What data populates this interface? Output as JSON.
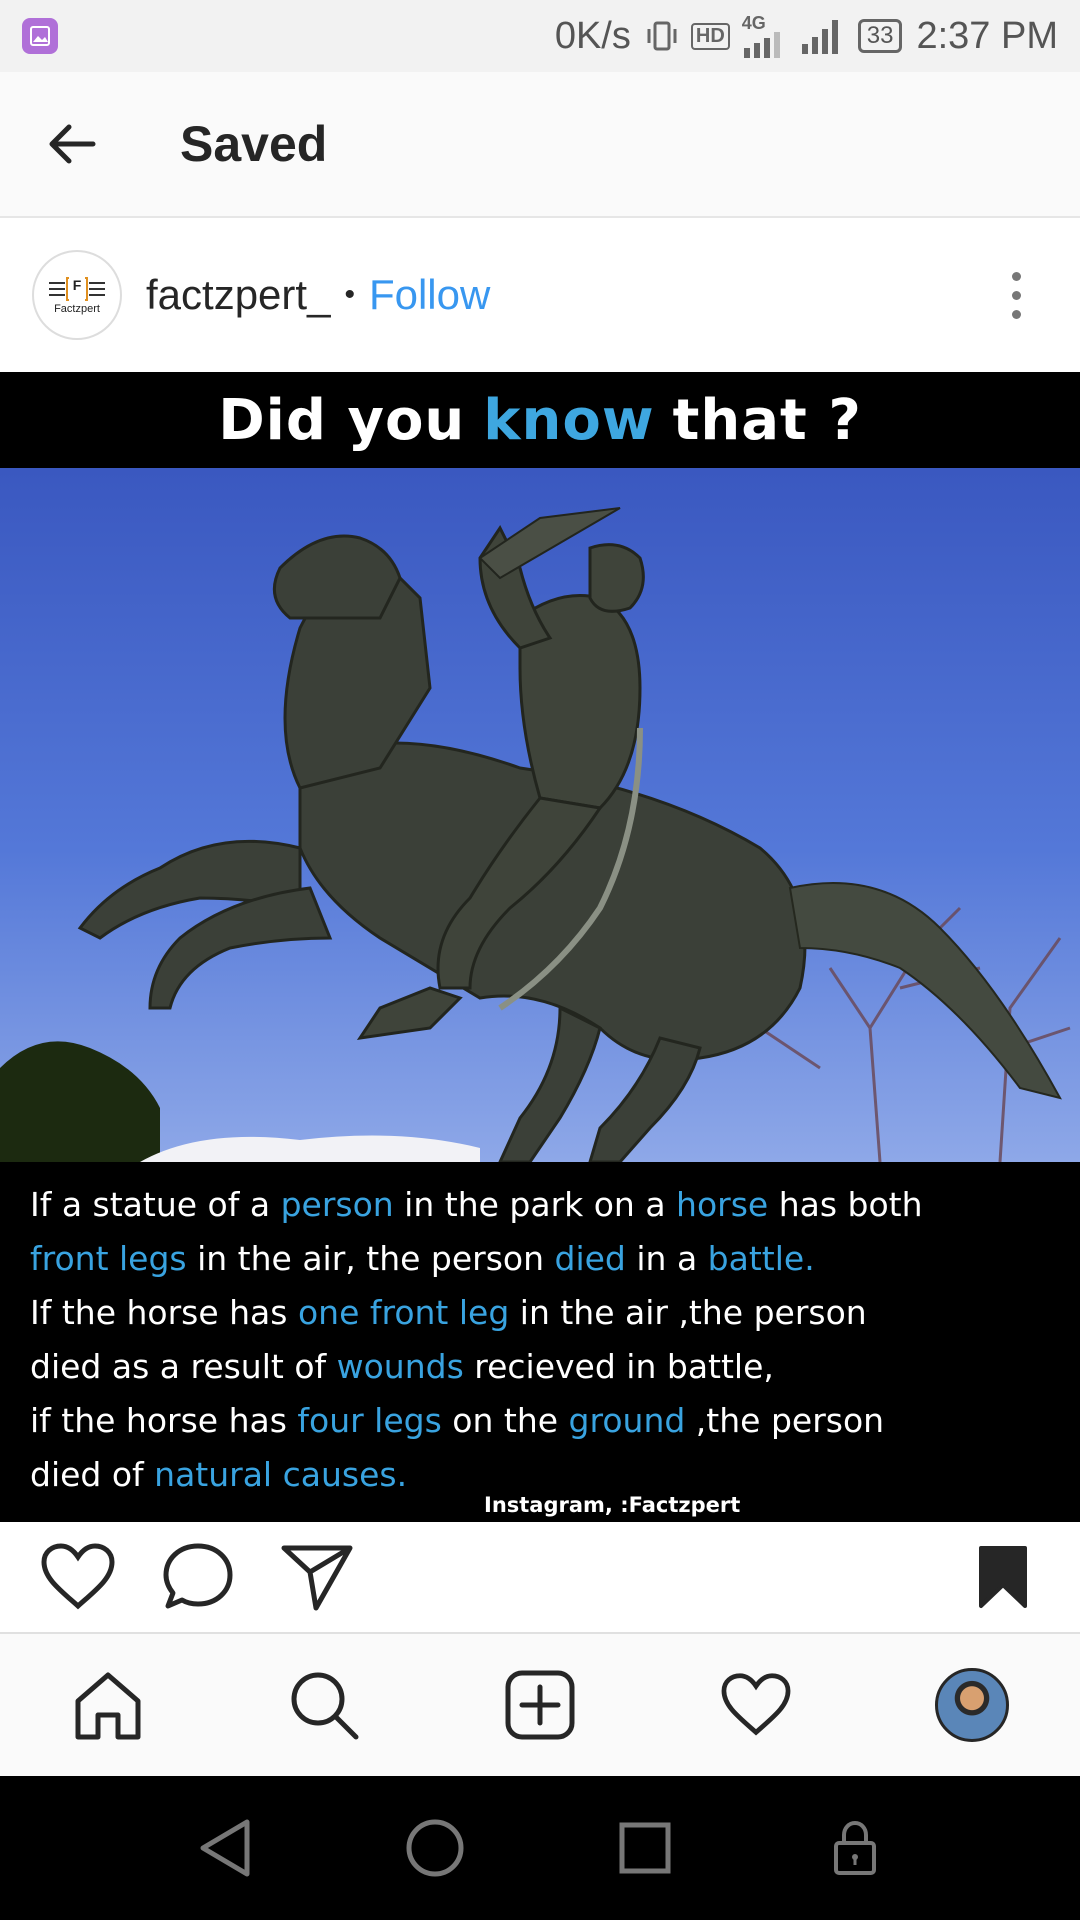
{
  "status_bar": {
    "network_speed": "0K/s",
    "hd_label": "HD",
    "network_type": "4G",
    "battery": "33",
    "time": "2:37 PM"
  },
  "app_bar": {
    "title": "Saved"
  },
  "post": {
    "avatar_letter": "F",
    "avatar_brand": "Factzpert",
    "username": "factzpert_",
    "separator": "•",
    "follow_label": "Follow",
    "image": {
      "heading_part1": "Did you",
      "heading_highlight": "know",
      "heading_part2": "that ?",
      "caption_lines": [
        [
          {
            "t": "If a statue of a ",
            "hl": false
          },
          {
            "t": "person",
            "hl": true
          },
          {
            "t": " in the park on a ",
            "hl": false
          },
          {
            "t": "horse",
            "hl": true
          },
          {
            "t": " has both",
            "hl": false
          }
        ],
        [
          {
            "t": "front legs",
            "hl": true
          },
          {
            "t": " in the air, the person ",
            "hl": false
          },
          {
            "t": "died",
            "hl": true
          },
          {
            "t": " in a ",
            "hl": false
          },
          {
            "t": "battle.",
            "hl": true
          }
        ],
        [
          {
            "t": "If the horse has ",
            "hl": false
          },
          {
            "t": "one front leg",
            "hl": true
          },
          {
            "t": " in the air ,the person",
            "hl": false
          }
        ],
        [
          {
            "t": "died as a result of ",
            "hl": false
          },
          {
            "t": "wounds",
            "hl": true
          },
          {
            "t": " recieved in battle,",
            "hl": false
          }
        ],
        [
          {
            "t": "if the horse has ",
            "hl": false
          },
          {
            "t": "four legs",
            "hl": true
          },
          {
            "t": " on the ",
            "hl": false
          },
          {
            "t": "ground",
            "hl": true
          },
          {
            "t": " ,the person",
            "hl": false
          }
        ],
        [
          {
            "t": "died of ",
            "hl": false
          },
          {
            "t": "natural causes.",
            "hl": true
          }
        ]
      ],
      "watermark": "Instagram, :Factzpert"
    }
  },
  "icons": {
    "back": "arrow-left",
    "more": "vertical-dots",
    "like": "heart-outline",
    "comment": "speech-bubble",
    "share": "paper-plane",
    "save": "bookmark-filled",
    "home": "home",
    "search": "magnifier",
    "new_post": "plus-square",
    "activity": "heart-outline",
    "profile": "profile-photo"
  },
  "colors": {
    "accent": "#3897f0",
    "caption_highlight": "#39a3e0"
  }
}
